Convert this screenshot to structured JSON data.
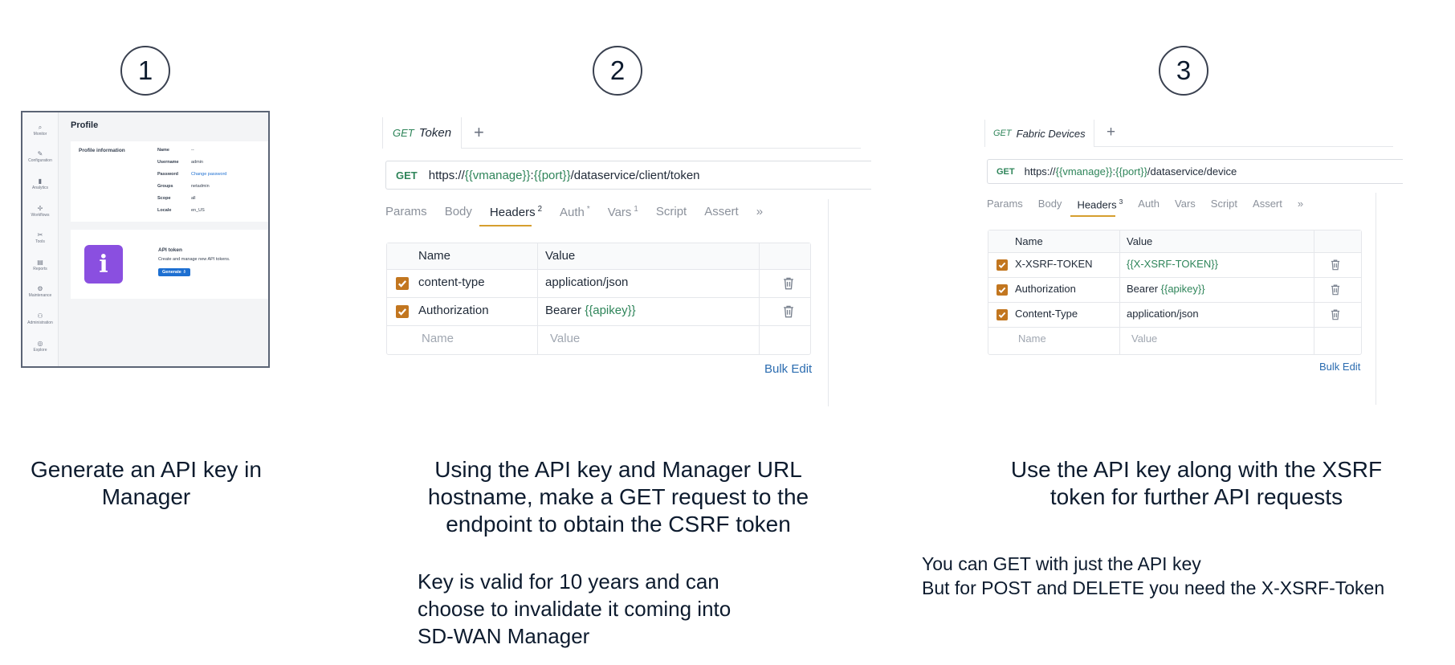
{
  "steps": [
    {
      "number": "1",
      "caption_lines": [
        "Generate an API key in",
        "Manager"
      ]
    },
    {
      "number": "2",
      "caption_lines": [
        "Using the API key and Manager URL",
        "hostname, make a GET request to the",
        "endpoint to obtain the CSRF token"
      ],
      "note_lines": [
        "Key is valid for 10 years and can",
        "choose to invalidate it coming into",
        "SD-WAN Manager"
      ]
    },
    {
      "number": "3",
      "caption_lines": [
        "Use the API key along with the XSRF",
        "token for further API requests"
      ],
      "note_lines": [
        "You can GET with just the API key",
        "But for POST and DELETE you need the X-XSRF-Token"
      ]
    }
  ],
  "manager_profile": {
    "title": "Profile",
    "nav_items": [
      "Monitor",
      "Configuration",
      "Analytics",
      "Workflows",
      "Tools",
      "Reports",
      "Maintenance",
      "Administration",
      "Explore"
    ],
    "info_label": "Profile information",
    "fields": [
      {
        "key": "Name",
        "value": "--"
      },
      {
        "key": "Username",
        "value": "admin"
      },
      {
        "key": "Password",
        "value": "Change password"
      },
      {
        "key": "Groups",
        "value": "netadmin"
      },
      {
        "key": "Scope",
        "value": "all"
      },
      {
        "key": "Locale",
        "value": "en_US"
      }
    ],
    "api_token": {
      "title": "API token",
      "description": "Create and manage new API tokens.",
      "button": "Generate"
    }
  },
  "request_token": {
    "tab_method": "GET",
    "tab_name": "Token",
    "url_method": "GET",
    "url_parts": [
      {
        "t": "https://",
        "v": false
      },
      {
        "t": "{{vmanage}}",
        "v": true
      },
      {
        "t": ":",
        "v": false
      },
      {
        "t": "{{port}}",
        "v": true
      },
      {
        "t": "/dataservice/client/token",
        "v": false
      }
    ],
    "subtabs": [
      {
        "label": "Params",
        "sup": ""
      },
      {
        "label": "Body",
        "sup": ""
      },
      {
        "label": "Headers",
        "sup": "2"
      },
      {
        "label": "Auth",
        "sup": "*"
      },
      {
        "label": "Vars",
        "sup": "1"
      },
      {
        "label": "Script",
        "sup": ""
      },
      {
        "label": "Assert",
        "sup": ""
      }
    ],
    "active_subtab": "Headers",
    "more": "»",
    "columns": [
      "Name",
      "Value"
    ],
    "headers": [
      {
        "name": "content-type",
        "value_plain": "application/json",
        "value_var": ""
      },
      {
        "name": "Authorization",
        "value_plain": "Bearer ",
        "value_var": "{{apikey}}"
      }
    ],
    "name_placeholder": "Name",
    "value_placeholder": "Value",
    "bulk_edit": "Bulk Edit"
  },
  "request_devices": {
    "tab_method": "GET",
    "tab_name": "Fabric Devices",
    "url_method": "GET",
    "url_parts": [
      {
        "t": "https://",
        "v": false
      },
      {
        "t": "{{vmanage}}",
        "v": true
      },
      {
        "t": ":",
        "v": false
      },
      {
        "t": "{{port}}",
        "v": true
      },
      {
        "t": "/dataservice/device",
        "v": false
      }
    ],
    "subtabs": [
      {
        "label": "Params",
        "sup": ""
      },
      {
        "label": "Body",
        "sup": ""
      },
      {
        "label": "Headers",
        "sup": "3"
      },
      {
        "label": "Auth",
        "sup": ""
      },
      {
        "label": "Vars",
        "sup": ""
      },
      {
        "label": "Script",
        "sup": ""
      },
      {
        "label": "Assert",
        "sup": ""
      }
    ],
    "active_subtab": "Headers",
    "more": "»",
    "columns": [
      "Name",
      "Value"
    ],
    "headers": [
      {
        "name": "X-XSRF-TOKEN",
        "value_plain": "",
        "value_var": "{{X-XSRF-TOKEN}}"
      },
      {
        "name": "Authorization",
        "value_plain": "Bearer ",
        "value_var": "{{apikey}}"
      },
      {
        "name": "Content-Type",
        "value_plain": "application/json",
        "value_var": ""
      }
    ],
    "name_placeholder": "Name",
    "value_placeholder": "Value",
    "bulk_edit": "Bulk Edit"
  },
  "colors": {
    "text": "#0d1b2e",
    "variable_green": "#2f855a",
    "checkbox_orange": "#c2761f",
    "tab_underline": "#d69e2e",
    "link_blue": "#2b6cb0",
    "api_icon_purple": "#8a4fe0"
  }
}
